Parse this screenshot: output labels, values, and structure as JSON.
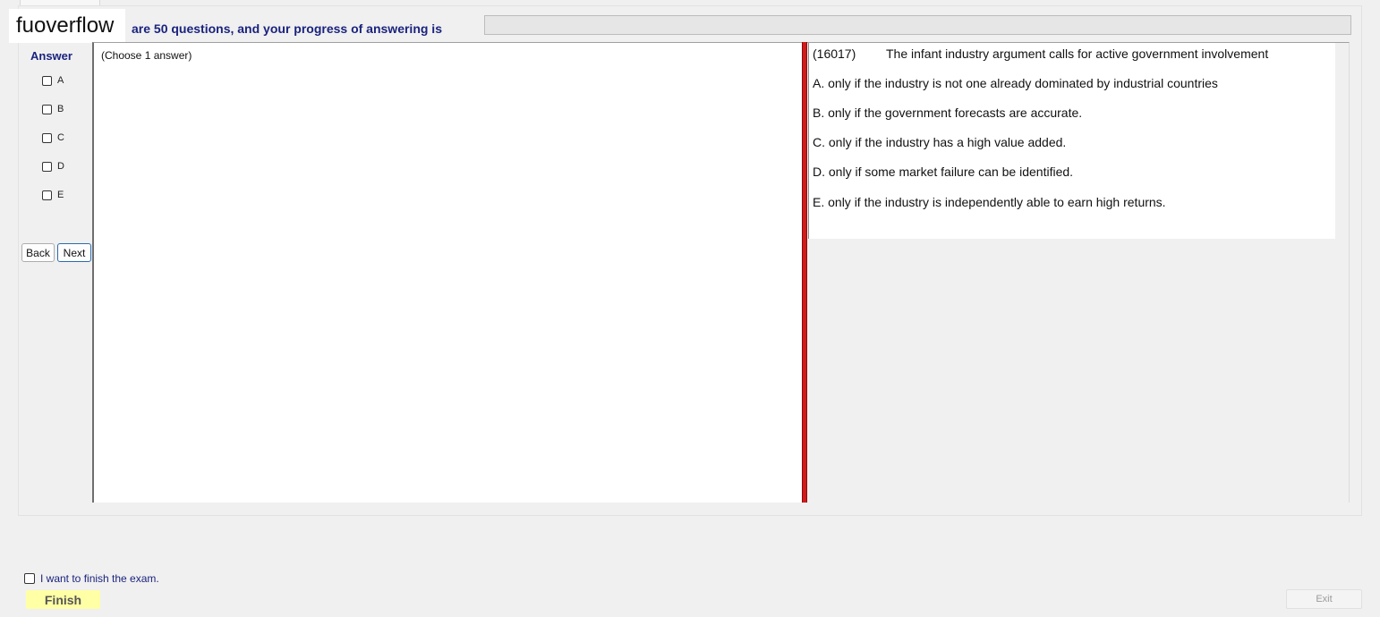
{
  "watermark": "fuoverflow",
  "header": {
    "progress_text": "are 50 questions, and your progress of answering is",
    "progress_fraction": 0
  },
  "answer": {
    "title": "Answer",
    "options": [
      "A",
      "B",
      "C",
      "D",
      "E"
    ]
  },
  "nav": {
    "back_label": "Back",
    "next_label": "Next"
  },
  "left_panel": {
    "instruction": "(Choose 1 answer)"
  },
  "question": {
    "id": "(16017)",
    "text": "The infant industry argument calls for active government involvement",
    "choices": [
      "A.  only if the industry is not one already dominated by industrial countries",
      "B.  only if the government forecasts are accurate.",
      "C.  only if the industry has a high value added.",
      "D.  only if some market failure can be identified.",
      "E.  only if the industry is independently able to earn high returns."
    ]
  },
  "footer": {
    "finish_checkbox_label": "I want to finish the exam.",
    "finish_label": "Finish",
    "exit_label": "Exit"
  },
  "colors": {
    "accent_blue": "#1a237e",
    "divider_red": "#d11a1a",
    "finish_yellow": "#ffffa6"
  }
}
